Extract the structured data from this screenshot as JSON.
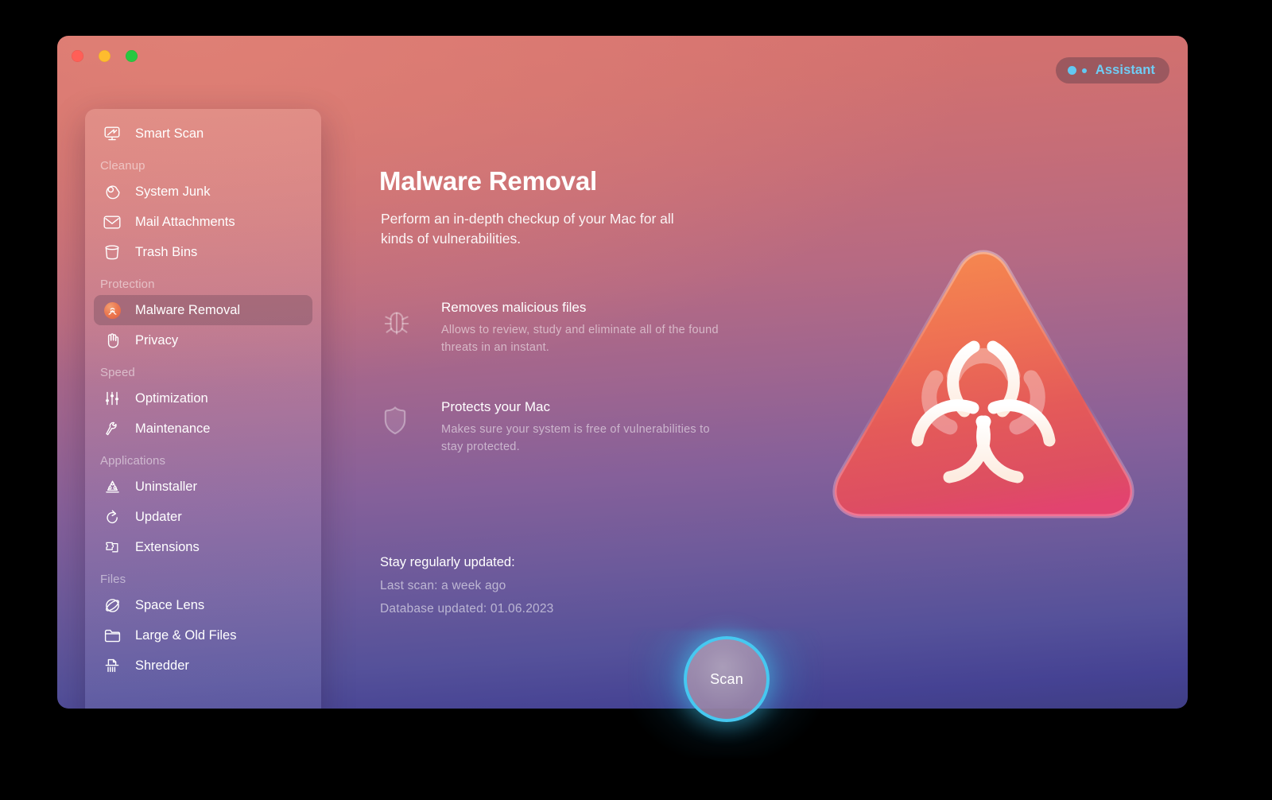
{
  "window": {
    "traffic_lights": [
      {
        "name": "close",
        "color": "#ff5f57"
      },
      {
        "name": "minimize",
        "color": "#febc2e"
      },
      {
        "name": "maximize",
        "color": "#28c840"
      }
    ],
    "accent_cyan": "#46c8f0",
    "gradient_top": "#d9726f",
    "gradient_bottom": "#3f3e85"
  },
  "assistant": {
    "label": "Assistant",
    "dot_color": "#63c8f2",
    "text_color": "#6fcdf5"
  },
  "sidebar": {
    "top_items": [
      {
        "label": "Smart Scan",
        "icon": "smart-scan-icon",
        "active": false
      }
    ],
    "groups": [
      {
        "label": "Cleanup",
        "items": [
          {
            "label": "System Junk",
            "icon": "system-junk-icon",
            "active": false
          },
          {
            "label": "Mail Attachments",
            "icon": "mail-envelope-icon",
            "active": false
          },
          {
            "label": "Trash Bins",
            "icon": "trash-bin-icon",
            "active": false
          }
        ]
      },
      {
        "label": "Protection",
        "items": [
          {
            "label": "Malware Removal",
            "icon": "biohazard-icon",
            "active": true
          },
          {
            "label": "Privacy",
            "icon": "hand-privacy-icon",
            "active": false
          }
        ]
      },
      {
        "label": "Speed",
        "items": [
          {
            "label": "Optimization",
            "icon": "sliders-icon",
            "active": false
          },
          {
            "label": "Maintenance",
            "icon": "wrench-icon",
            "active": false
          }
        ]
      },
      {
        "label": "Applications",
        "items": [
          {
            "label": "Uninstaller",
            "icon": "uninstaller-icon",
            "active": false
          },
          {
            "label": "Updater",
            "icon": "updater-arrow-icon",
            "active": false
          },
          {
            "label": "Extensions",
            "icon": "puzzle-piece-icon",
            "active": false
          }
        ]
      },
      {
        "label": "Files",
        "items": [
          {
            "label": "Space Lens",
            "icon": "space-lens-icon",
            "active": false
          },
          {
            "label": "Large & Old Files",
            "icon": "folder-icon",
            "active": false
          },
          {
            "label": "Shredder",
            "icon": "shredder-icon",
            "active": false
          }
        ]
      }
    ]
  },
  "main": {
    "title": "Malware Removal",
    "description": "Perform an in-depth checkup of your Mac for all kinds of vulnerabilities.",
    "features": [
      {
        "icon": "bug-icon",
        "title": "Removes malicious files",
        "subtitle": "Allows to review, study and eliminate all of the found threats in an instant."
      },
      {
        "icon": "shield-icon",
        "title": "Protects your Mac",
        "subtitle": "Makes sure your system is free of vulnerabilities to stay protected."
      }
    ],
    "updated": {
      "title": "Stay regularly updated:",
      "last_scan": "Last scan: a week ago",
      "database": "Database updated: 01.06.2023"
    },
    "hero_icon": "biohazard-warning-triangle-icon"
  },
  "scan_button": {
    "label": "Scan",
    "ring_color": "#46c8f0"
  }
}
